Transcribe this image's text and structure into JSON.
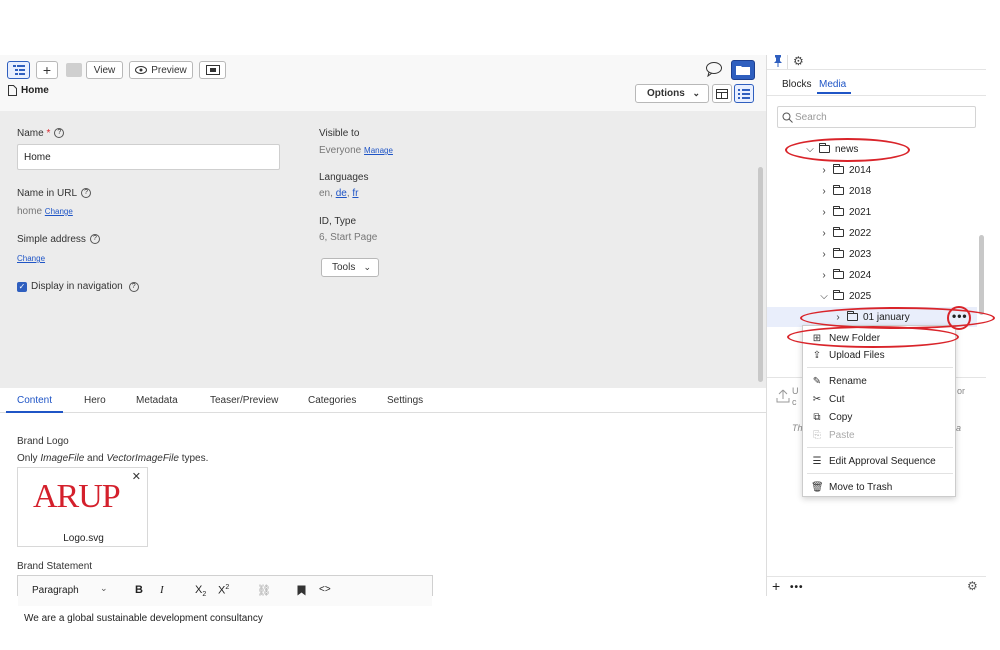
{
  "toolbar": {
    "view_label": "View",
    "preview_label": "Preview",
    "plus_label": "+",
    "options_label": "Options",
    "breadcrumb_title": "Home"
  },
  "props": {
    "name_label": "Name",
    "name_required": "*",
    "name_value": "Home",
    "name_in_url_label": "Name in URL",
    "name_in_url_value": "home",
    "change_link": "Change",
    "simple_address_label": "Simple address",
    "simple_address_change": "Change",
    "display_nav_label": "Display in navigation",
    "visible_to_label": "Visible to",
    "visible_to_value": "Everyone",
    "manage_link": "Manage",
    "languages_label": "Languages",
    "lang_en": "en,",
    "lang_de": "de",
    "lang_comma": ",",
    "lang_fr": "fr",
    "id_type_label": "ID, Type",
    "id_type_value": "6, Start Page",
    "tools_label": "Tools"
  },
  "tabs": [
    "Content",
    "Hero",
    "Metadata",
    "Teaser/Preview",
    "Categories",
    "Settings"
  ],
  "content": {
    "brand_logo_label": "Brand Logo",
    "only_prefix": "Only ",
    "image_file": "ImageFile",
    "and_text": " and ",
    "vector_file": "VectorImageFile",
    "types_suffix": " types.",
    "logo_text": "ARUP",
    "logo_filename": "Logo.svg",
    "brand_statement_label": "Brand Statement",
    "paragraph_select": "Paragraph",
    "statement_text": "We are a global sustainable development consultancy"
  },
  "rpanel": {
    "tab_blocks": "Blocks",
    "tab_media": "Media",
    "search_placeholder": "Search",
    "tree": {
      "news": "news",
      "y2014": "2014",
      "y2018": "2018",
      "y2021": "2021",
      "y2022": "2022",
      "y2023": "2023",
      "y2024": "2024",
      "y2025": "2025",
      "jan": "01 january"
    },
    "partial_u": "U",
    "partial_or": "or",
    "partial_c": "c",
    "partial_th": "Th",
    "partial_a": "a"
  },
  "context_menu": {
    "new_folder": "New Folder",
    "upload_files": "Upload Files",
    "rename": "Rename",
    "cut": "Cut",
    "copy": "Copy",
    "paste": "Paste",
    "edit_approval": "Edit Approval Sequence",
    "move_to_trash": "Move to Trash"
  },
  "colors": {
    "accent": "#1f55c6",
    "annotation_red": "#d9242a",
    "arup_red": "#d4202c",
    "props_bg": "#ececec"
  }
}
